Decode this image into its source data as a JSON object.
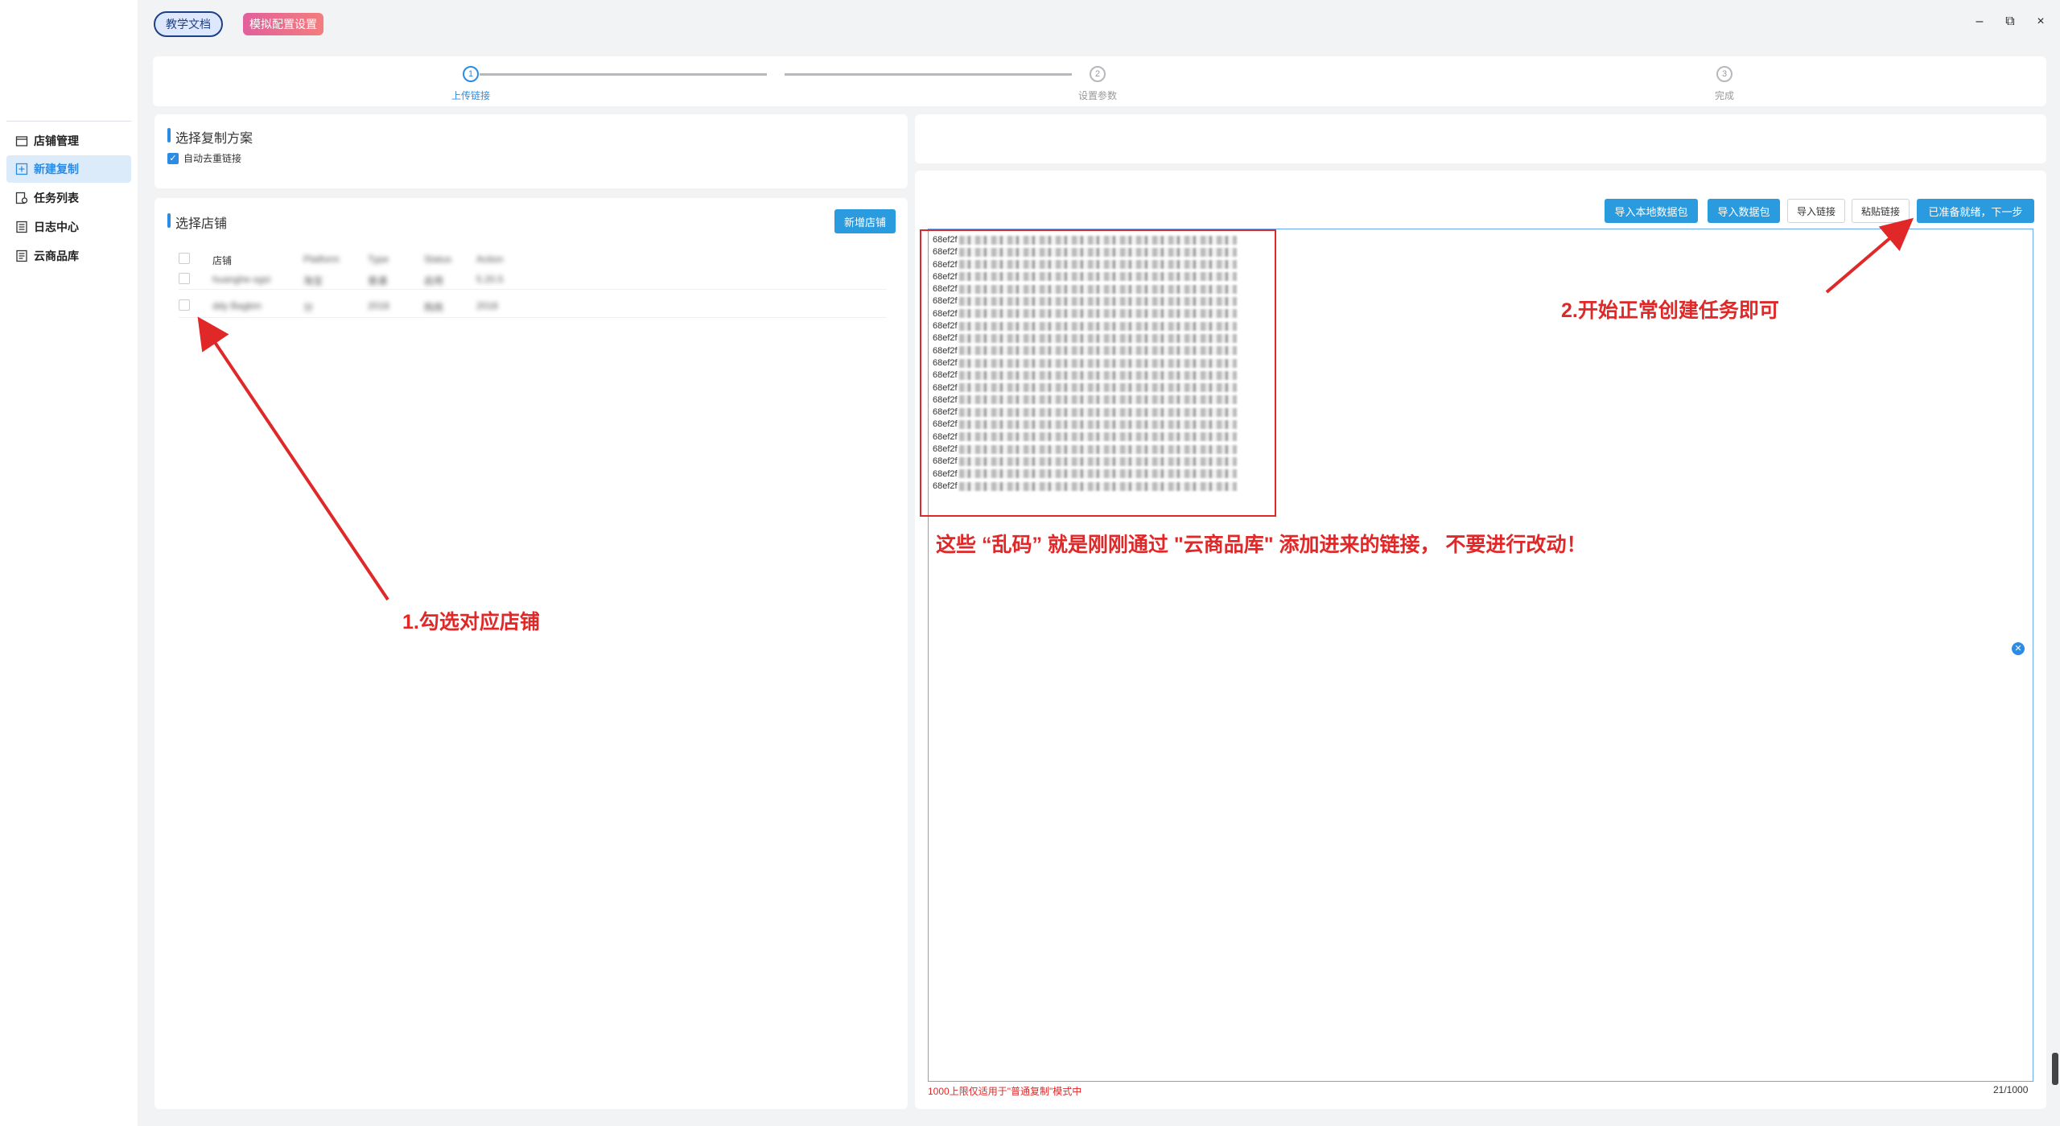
{
  "header": {
    "docs_label": "教学文档",
    "sim_label": "模拟配置设置",
    "minimize": "–",
    "restore": "⧉",
    "close": "×"
  },
  "sidebar": {
    "items": [
      {
        "label": "店铺管理",
        "icon": "store-icon",
        "active": false
      },
      {
        "label": "新建复制",
        "icon": "add-copy-icon",
        "active": true
      },
      {
        "label": "任务列表",
        "icon": "task-list-icon",
        "active": false
      },
      {
        "label": "日志中心",
        "icon": "log-icon",
        "active": false
      },
      {
        "label": "云商品库",
        "icon": "cloud-library-icon",
        "active": false
      }
    ]
  },
  "stepper": {
    "steps": [
      {
        "num": "1",
        "label": "上传链接",
        "active": true
      },
      {
        "num": "2",
        "label": "设置参数",
        "active": false
      },
      {
        "num": "3",
        "label": "完成",
        "active": false
      }
    ]
  },
  "copy_plan": {
    "title": "选择复制方案",
    "auto_dedupe_label": "自动去重链接",
    "auto_dedupe_checked": true
  },
  "store_select": {
    "title": "选择店铺",
    "add_button": "新增店铺",
    "columns": [
      "店铺",
      "Platform",
      "Type",
      "Status",
      "Action"
    ],
    "rows": [
      [
        "huanghe-sgsi",
        "淘宝",
        "普通",
        "启用",
        "5.20.5"
      ],
      [
        "ddy Bagbm",
        "分",
        "2018",
        "购商",
        "2018"
      ]
    ]
  },
  "links_panel": {
    "buttons": {
      "import_local": "导入本地数据包",
      "import_pack": "导入数据包",
      "import_link": "导入链接",
      "paste_link": "粘贴链接",
      "ready_next": "已准备就绪，下一步"
    },
    "link_prefix": "68ef2f",
    "link_count": 21,
    "footer_hint": "1000上限仅适用于\"普通复制\"模式中",
    "counter": "21/1000"
  },
  "annotations": {
    "step1": "1.勾选对应店铺",
    "step2": "2.开始正常创建任务即可",
    "garbled_note": "这些 “乱码” 就是刚刚通过 \"云商品库\" 添加进来的链接， 不要进行改动！"
  },
  "colors": {
    "accent": "#2b8ce6",
    "primary_button": "#2b9bdf",
    "annotation_red": "#e02828"
  }
}
